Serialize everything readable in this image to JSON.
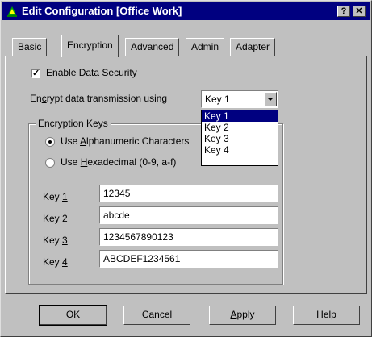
{
  "window": {
    "title": "Edit Configuration [Office Work]",
    "help_button": "?",
    "close_button": "✕",
    "icon": "network-config-icon"
  },
  "tabs": [
    "Basic",
    "Encryption",
    "Advanced",
    "Admin",
    "Adapter"
  ],
  "active_tab": "Encryption",
  "enable_security": {
    "label": "Enable Data Security",
    "checked": true
  },
  "encrypt_using": {
    "label": "Encrypt data transmission using",
    "selected": "Key 1",
    "options": [
      "Key 1",
      "Key 2",
      "Key 3",
      "Key 4"
    ]
  },
  "encryption_keys": {
    "title": "Encryption Keys",
    "radio_alpha": {
      "label": "Use Alphanumeric Characters",
      "checked": true
    },
    "radio_hex": {
      "label": "Use Hexadecimal (0-9, a-f)",
      "checked": false
    },
    "keys": [
      {
        "label": "Key 1",
        "value": "12345"
      },
      {
        "label": "Key 2",
        "value": "abcde"
      },
      {
        "label": "Key 3",
        "value": "1234567890123"
      },
      {
        "label": "Key 4",
        "value": "ABCDEF1234561"
      }
    ]
  },
  "buttons": {
    "ok": "OK",
    "cancel": "Cancel",
    "apply": "Apply",
    "help": "Help"
  },
  "colors": {
    "title_bar": "#000080",
    "face": "#c0c0c0",
    "selection": "#000080"
  }
}
